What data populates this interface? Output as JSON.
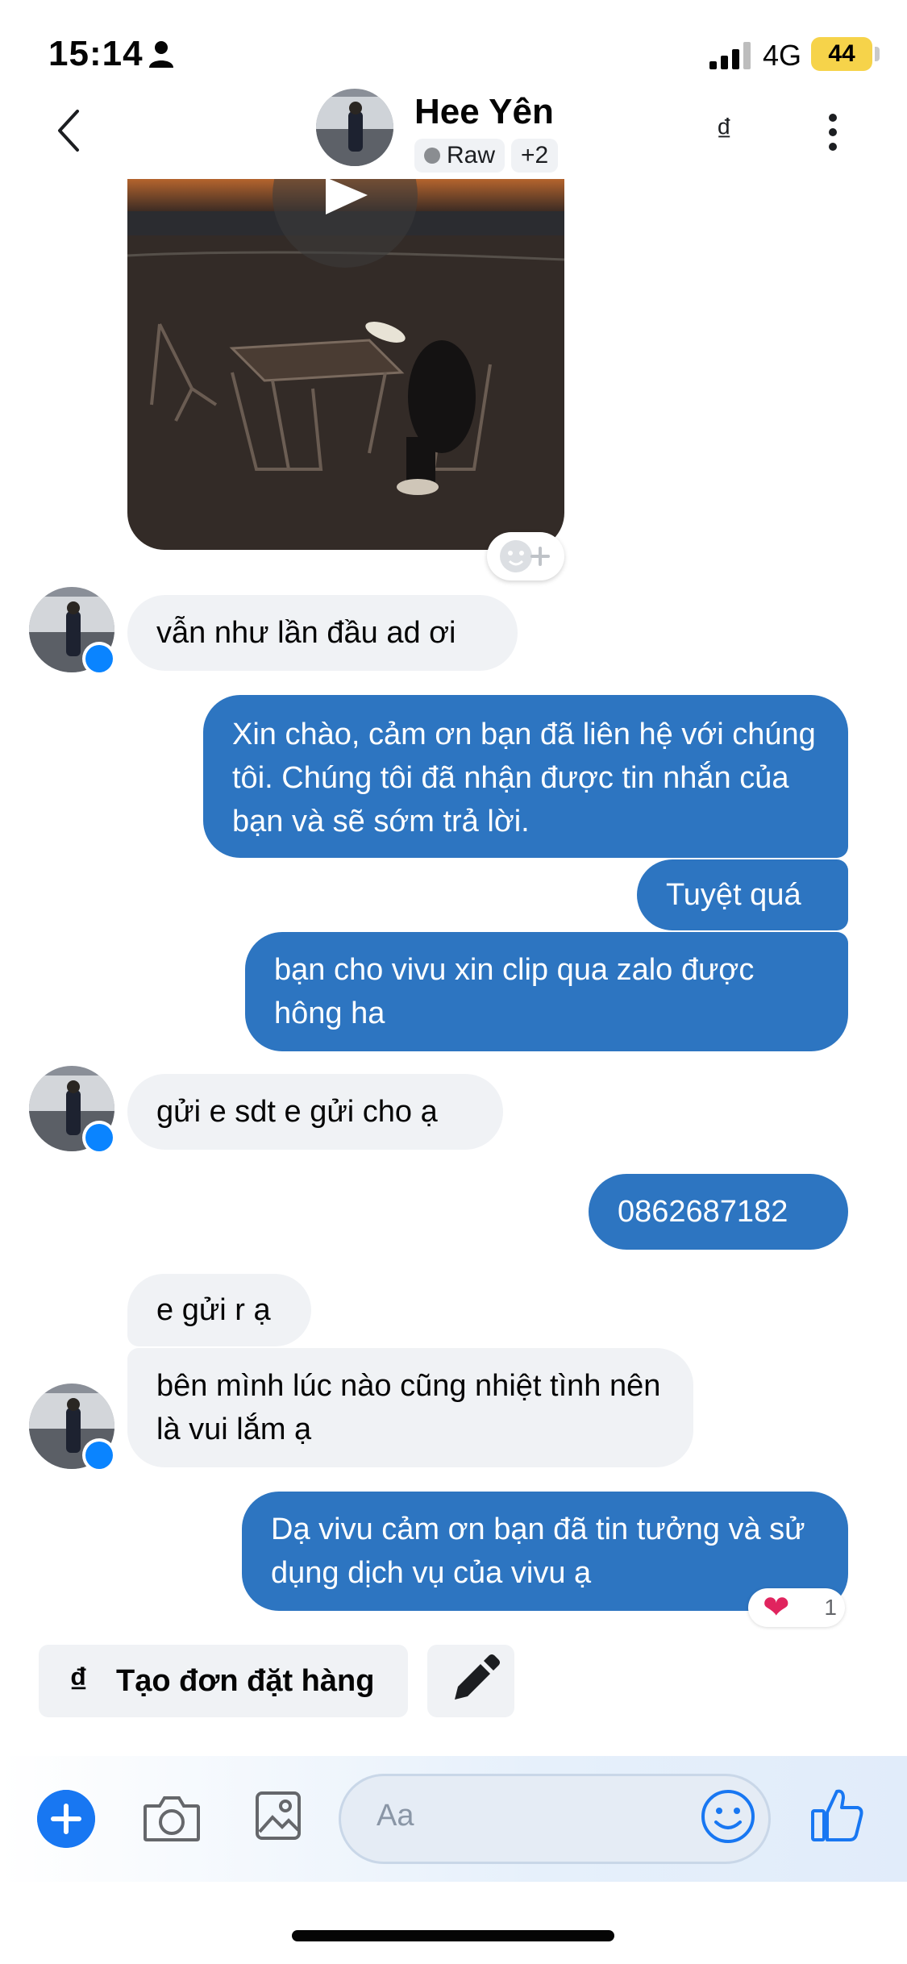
{
  "status_bar": {
    "time": "15:14",
    "network": "4G",
    "battery": "44",
    "icons": [
      "person-icon",
      "signal-icon",
      "battery-icon"
    ]
  },
  "header": {
    "name": "Hee Yên",
    "tag_label": "Raw",
    "tag_more": "+2",
    "currency_symbol": "₫",
    "icons": [
      "back-icon",
      "more-icon"
    ]
  },
  "messages": [
    {
      "from": "contact",
      "text": "vẫn như lần đầu ad ơi"
    },
    {
      "from": "page",
      "text": "Xin chào, cảm ơn bạn đã liên hệ với chúng tôi. Chúng tôi đã nhận được tin nhắn của bạn và sẽ sớm trả lời."
    },
    {
      "from": "page",
      "text": "Tuyệt quá"
    },
    {
      "from": "page",
      "text": "bạn cho vivu xin clip qua zalo được hông ha"
    },
    {
      "from": "contact",
      "text": "gửi e sdt e gửi cho ạ"
    },
    {
      "from": "page",
      "text": "0862687182"
    },
    {
      "from": "contact",
      "text": "e gửi r ạ"
    },
    {
      "from": "contact",
      "text": "bên mình lúc nào cũng nhiệt tình nên là vui lắm ạ"
    },
    {
      "from": "page",
      "text": "Dạ vivu cảm ơn bạn đã tin tưởng và sử dụng dịch vụ của vivu ạ"
    }
  ],
  "reaction": {
    "emoji": "❤",
    "count": "1"
  },
  "quick_actions": {
    "order_symbol": "₫",
    "order_label": "Tạo đơn đặt hàng",
    "edit_icon": "pencil-icon"
  },
  "composer": {
    "placeholder": "Aa",
    "icons": [
      "plus-icon",
      "camera-icon",
      "image-icon",
      "emoji-icon",
      "thumbs-up-icon"
    ]
  },
  "colors": {
    "outgoing_bubble": "#2d75c1",
    "incoming_bubble": "#f0f2f5",
    "accent": "#1877f2"
  }
}
